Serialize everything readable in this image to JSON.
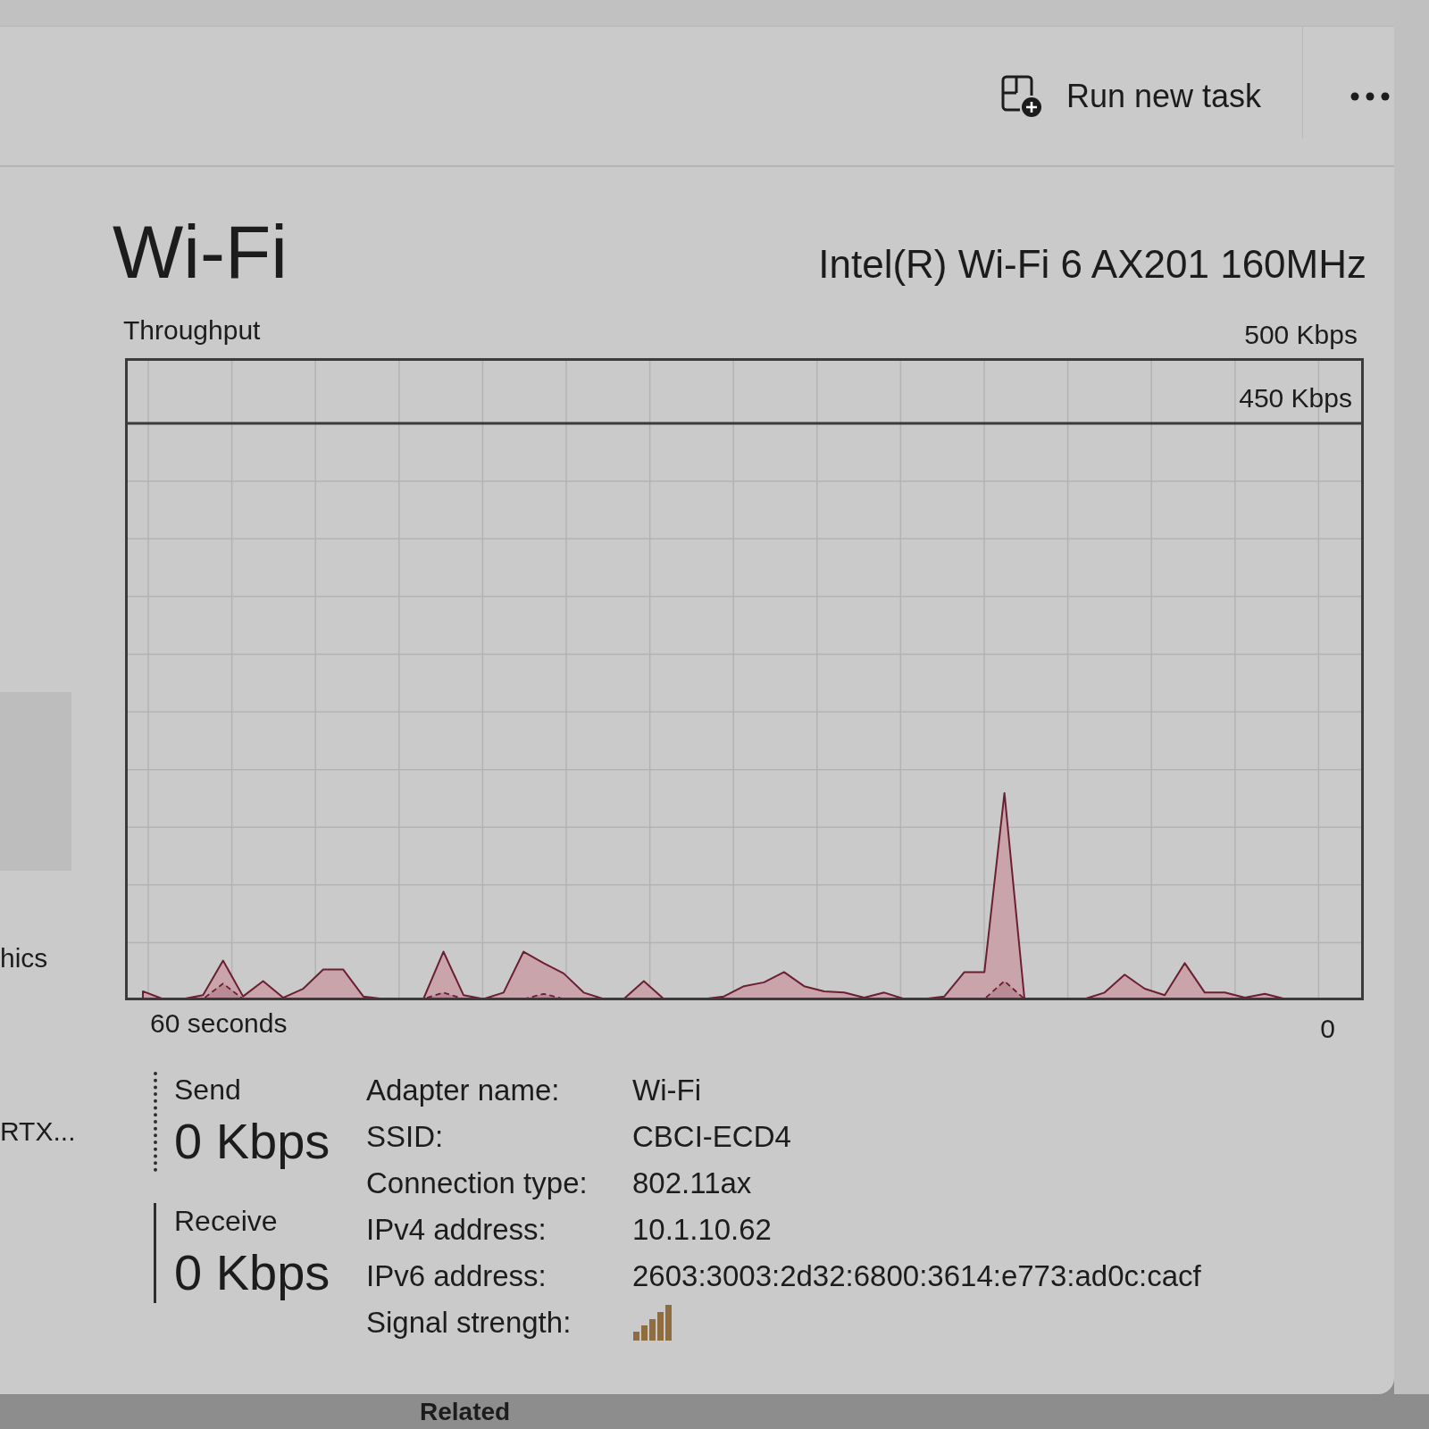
{
  "toolbar": {
    "run_task_label": "Run new task"
  },
  "sidebar": {
    "items": [
      {
        "label": "hics"
      },
      {
        "label": "RTX..."
      }
    ]
  },
  "header": {
    "title": "Wi-Fi",
    "adapter": "Intel(R) Wi-Fi 6 AX201 160MHz"
  },
  "throughput": {
    "title": "Throughput",
    "max_label": "500 Kbps",
    "band_label": "450 Kbps",
    "time_start": "60 seconds",
    "time_end": "0"
  },
  "stats": [
    {
      "label": "Send",
      "value": "0 Kbps",
      "kind": "dotted"
    },
    {
      "label": "Receive",
      "value": "0 Kbps",
      "kind": "solid"
    }
  ],
  "details": [
    {
      "label": "Adapter name:",
      "value": "Wi-Fi",
      "kind": "text"
    },
    {
      "label": "SSID:",
      "value": "CBCI-ECD4",
      "kind": "text"
    },
    {
      "label": "Connection type:",
      "value": "802.11ax",
      "kind": "text"
    },
    {
      "label": "IPv4 address:",
      "value": "10.1.10.62",
      "kind": "text"
    },
    {
      "label": "IPv6 address:",
      "value": "2603:3003:2d32:6800:3614:e773:ad0c:cacf",
      "kind": "text"
    },
    {
      "label": "Signal strength:",
      "kind": "signal"
    }
  ],
  "behind_window": {
    "heading": "Related"
  }
}
